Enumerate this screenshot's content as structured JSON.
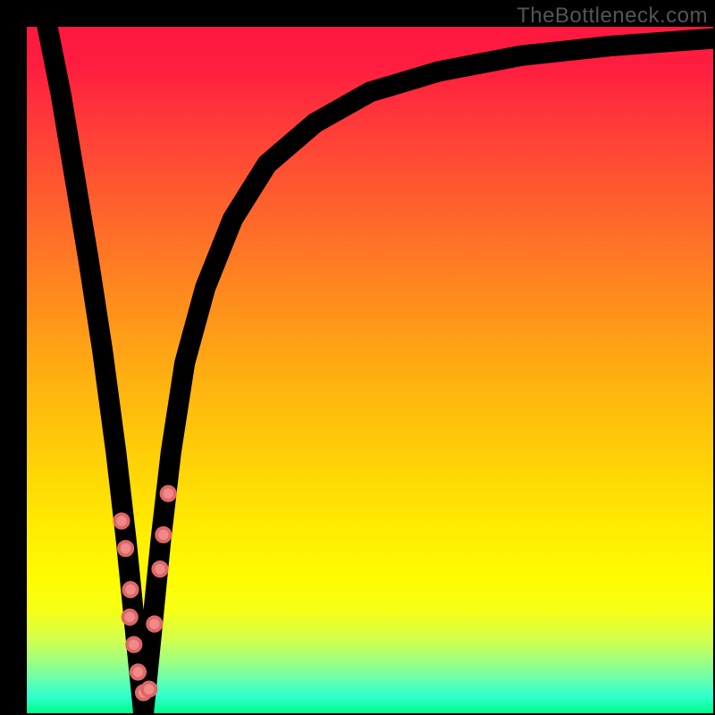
{
  "watermark": "TheBottleneck.com",
  "chart_data": {
    "type": "line",
    "title": "",
    "xlabel": "",
    "ylabel": "",
    "xlim": [
      0,
      100
    ],
    "ylim": [
      0,
      100
    ],
    "grid": false,
    "legend": false,
    "background_gradient": {
      "top": "#ff173f",
      "mid": "#fffb00",
      "bottom": "#00ff88"
    },
    "series": [
      {
        "name": "bottleneck-curve",
        "x_minimum": 17,
        "x": [
          3,
          5,
          7,
          9,
          11,
          13,
          14.5,
          16,
          17,
          18,
          19.5,
          21,
          23,
          26,
          30,
          35,
          42,
          50,
          60,
          72,
          85,
          100
        ],
        "values": [
          100,
          90,
          78,
          66,
          53,
          38,
          25,
          10,
          0,
          10,
          25,
          38,
          51,
          62,
          72,
          80,
          86,
          90.5,
          93.5,
          95.8,
          97.2,
          98.3
        ]
      }
    ],
    "points": {
      "name": "highlight-dots",
      "xy": [
        [
          13.8,
          28
        ],
        [
          14.4,
          24
        ],
        [
          15.1,
          18
        ],
        [
          15.0,
          14
        ],
        [
          15.6,
          10
        ],
        [
          16.2,
          6
        ],
        [
          17.0,
          3
        ],
        [
          17.8,
          3.5
        ],
        [
          18.6,
          13
        ],
        [
          19.4,
          21
        ],
        [
          19.9,
          26
        ],
        [
          20.6,
          32
        ]
      ]
    }
  }
}
